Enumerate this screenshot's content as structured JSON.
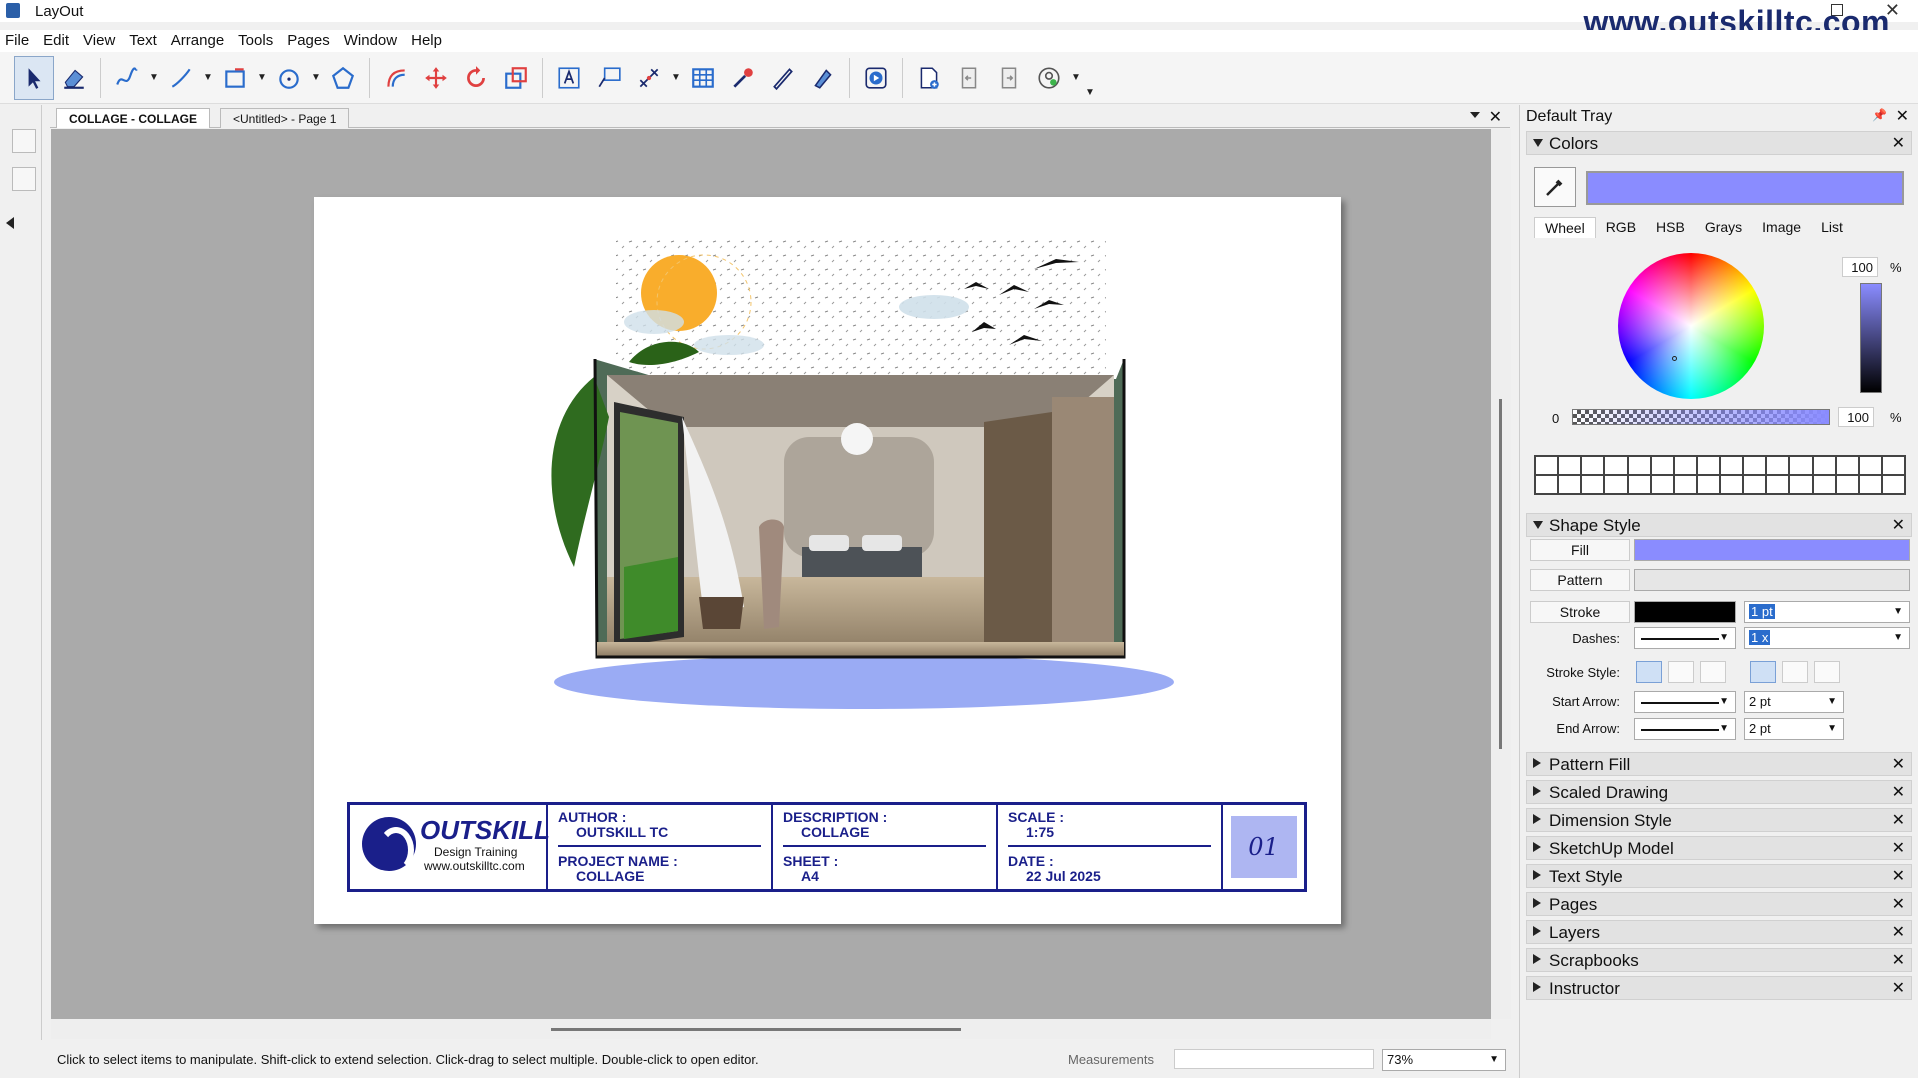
{
  "window": {
    "title": "LayOut",
    "watermark": "www.outskilltc.com"
  },
  "menu": [
    "File",
    "Edit",
    "View",
    "Text",
    "Arrange",
    "Tools",
    "Pages",
    "Window",
    "Help"
  ],
  "tabs": {
    "document": "COLLAGE - COLLAGE",
    "page": "<Untitled> - Page 1"
  },
  "titleblock": {
    "logo_name": "OUTSKILL",
    "logo_sub": "Design Training",
    "logo_url": "www.outskilltc.com",
    "author_label": "AUTHOR :",
    "author": "OUTSKILL TC",
    "project_label": "PROJECT NAME :",
    "project": "COLLAGE",
    "description_label": "DESCRIPTION :",
    "description": "COLLAGE",
    "sheet_label": "SHEET :",
    "sheet": "A4",
    "scale_label": "SCALE :",
    "scale": "1:75",
    "date_label": "DATE :",
    "date": "22 Jul 2025",
    "sheet_number": "01"
  },
  "tray": {
    "title": "Default Tray",
    "colors": {
      "title": "Colors",
      "current_color": "#8a8cff",
      "tabs": [
        "Wheel",
        "RGB",
        "HSB",
        "Grays",
        "Image",
        "List"
      ],
      "brightness": "100",
      "opacity_min": "0",
      "opacity": "100",
      "pct": "%"
    },
    "shape_style": {
      "title": "Shape Style",
      "fill_label": "Fill",
      "fill_color": "#8a8cff",
      "pattern_label": "Pattern",
      "stroke_label": "Stroke",
      "stroke_color": "#000000",
      "stroke_width": "1 pt",
      "dashes_label": "Dashes:",
      "dash_scale": "1 x",
      "stroke_style_label": "Stroke Style:",
      "start_arrow_label": "Start Arrow:",
      "start_arrow_size": "2 pt",
      "end_arrow_label": "End Arrow:",
      "end_arrow_size": "2 pt"
    },
    "collapsed_panels": [
      "Pattern Fill",
      "Scaled Drawing",
      "Dimension Style",
      "SketchUp Model",
      "Text Style",
      "Pages",
      "Layers",
      "Scrapbooks",
      "Instructor"
    ]
  },
  "status": {
    "hint": "Click to select items to manipulate. Shift-click to extend selection. Click-drag to select multiple. Double-click to open editor.",
    "measurements_label": "Measurements",
    "zoom": "73%"
  }
}
